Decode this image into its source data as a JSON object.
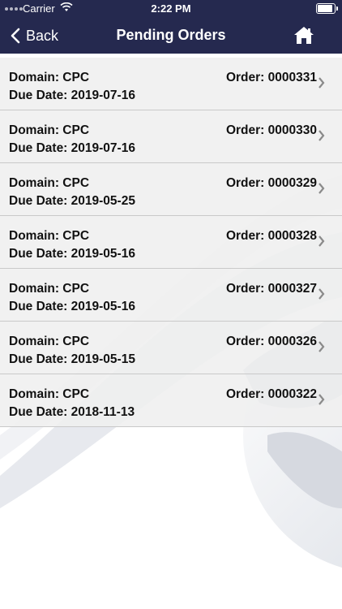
{
  "status_bar": {
    "carrier": "Carrier",
    "time": "2:22 PM"
  },
  "nav": {
    "back_label": "Back",
    "title": "Pending Orders"
  },
  "colors": {
    "nav_bg": "#25294f",
    "row_bg": "#efefef"
  },
  "orders": [
    {
      "domain": "Domain: CPC",
      "due": "Due Date: 2019-07-16",
      "order": "Order: 0000331"
    },
    {
      "domain": "Domain: CPC",
      "due": "Due Date: 2019-07-16",
      "order": "Order: 0000330"
    },
    {
      "domain": "Domain: CPC",
      "due": "Due Date: 2019-05-25",
      "order": "Order: 0000329"
    },
    {
      "domain": "Domain: CPC",
      "due": "Due Date: 2019-05-16",
      "order": "Order: 0000328"
    },
    {
      "domain": "Domain: CPC",
      "due": "Due Date: 2019-05-16",
      "order": "Order: 0000327"
    },
    {
      "domain": "Domain: CPC",
      "due": "Due Date: 2019-05-15",
      "order": "Order: 0000326"
    },
    {
      "domain": "Domain: CPC",
      "due": "Due Date: 2018-11-13",
      "order": "Order: 0000322"
    }
  ],
  "icons": {
    "back": "chevron-left-icon",
    "home": "home-icon",
    "row": "chevron-right-icon"
  }
}
